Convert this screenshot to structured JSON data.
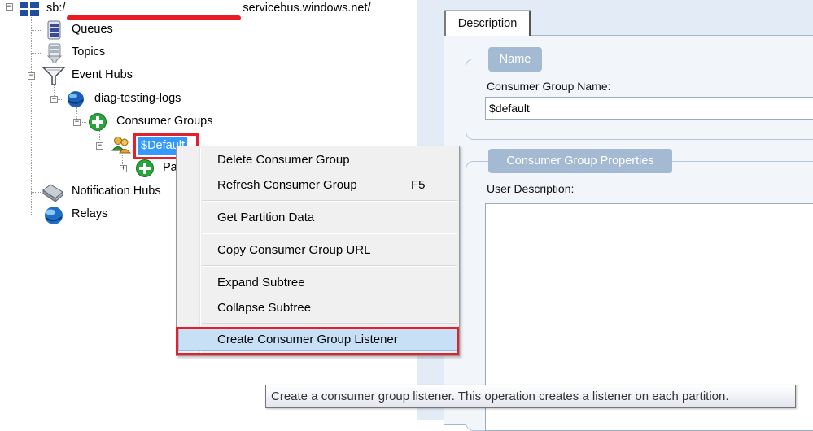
{
  "tree": {
    "root": {
      "label_prefix": "sb:/",
      "label_suffix": "servicebus.windows.net/"
    },
    "queues": "Queues",
    "topics": "Topics",
    "event_hubs": "Event Hubs",
    "hub": "diag-testing-logs",
    "consumer_groups": "Consumer Groups",
    "default_group": "$Default",
    "partitions_partial": "Pa",
    "notification_hubs": "Notification Hubs",
    "relays": "Relays"
  },
  "panel": {
    "tab_label": "Description",
    "name_group": {
      "title": "Name",
      "field_label": "Consumer Group Name:",
      "field_value": "$default"
    },
    "properties_group": {
      "title": "Consumer Group Properties",
      "field_label": "User Description:"
    }
  },
  "context_menu": {
    "items": [
      {
        "label": "Delete Consumer Group",
        "shortcut": ""
      },
      {
        "label": "Refresh Consumer Group",
        "shortcut": "F5"
      },
      {
        "label": "Get Partition Data",
        "shortcut": ""
      },
      {
        "label": "Copy Consumer Group URL",
        "shortcut": ""
      },
      {
        "label": "Expand Subtree",
        "shortcut": ""
      },
      {
        "label": "Collapse Subtree",
        "shortcut": ""
      },
      {
        "label": "Create Consumer Group Listener",
        "shortcut": ""
      }
    ],
    "highlighted_item": "Create Consumer Group Listener"
  },
  "tooltip": "Create a consumer group listener. This operation creates a listener on each partition.",
  "colors": {
    "selection": "#3399ff",
    "annotation_red": "#e3202b",
    "panel_bg": "#e3ebf6",
    "group_title_bg": "#a4b9d2"
  },
  "icons": {
    "root": "windows-logo-icon",
    "queues": "database-stack-icon",
    "topics": "funnel-stack-icon",
    "event_hubs": "funnel-icon",
    "hub": "globe-icon",
    "consumer_groups": "green-plus-icon",
    "default_group": "users-icon",
    "notification_hubs": "device-icon",
    "relays": "globe-icon"
  }
}
